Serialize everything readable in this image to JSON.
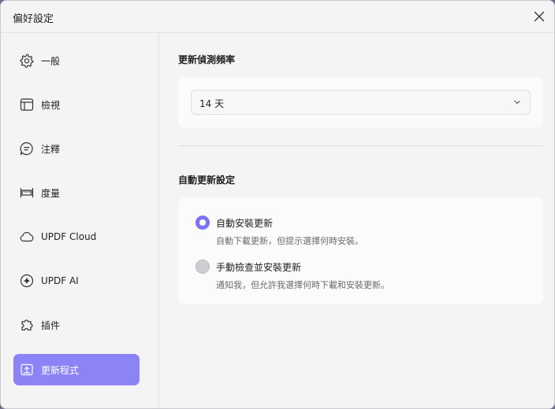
{
  "window": {
    "title": "偏好設定",
    "close_icon": "close-icon"
  },
  "sidebar": {
    "items": [
      {
        "label": "一般",
        "icon": "gear-icon",
        "active": false
      },
      {
        "label": "檢視",
        "icon": "layout-icon",
        "active": false
      },
      {
        "label": "注釋",
        "icon": "comment-icon",
        "active": false
      },
      {
        "label": "度量",
        "icon": "ruler-icon",
        "active": false
      },
      {
        "label": "UPDF Cloud",
        "icon": "cloud-icon",
        "active": false
      },
      {
        "label": "UPDF AI",
        "icon": "ai-sparkle-icon",
        "active": false
      },
      {
        "label": "插件",
        "icon": "puzzle-icon",
        "active": false
      },
      {
        "label": "更新程式",
        "icon": "update-icon",
        "active": true
      }
    ]
  },
  "main": {
    "frequency": {
      "title": "更新偵測頻率",
      "selected": "14 天"
    },
    "auto_update": {
      "title": "自動更新設定",
      "options": [
        {
          "label": "自動安裝更新",
          "description": "自動下載更新，但提示選擇何時安裝。",
          "selected": true
        },
        {
          "label": "手動檢查並安裝更新",
          "description": "通知我，但允許我選擇何時下載和安裝更新。",
          "selected": false
        }
      ]
    }
  },
  "colors": {
    "accent": "#8c84f6",
    "radio_on": "#7b73f2"
  }
}
